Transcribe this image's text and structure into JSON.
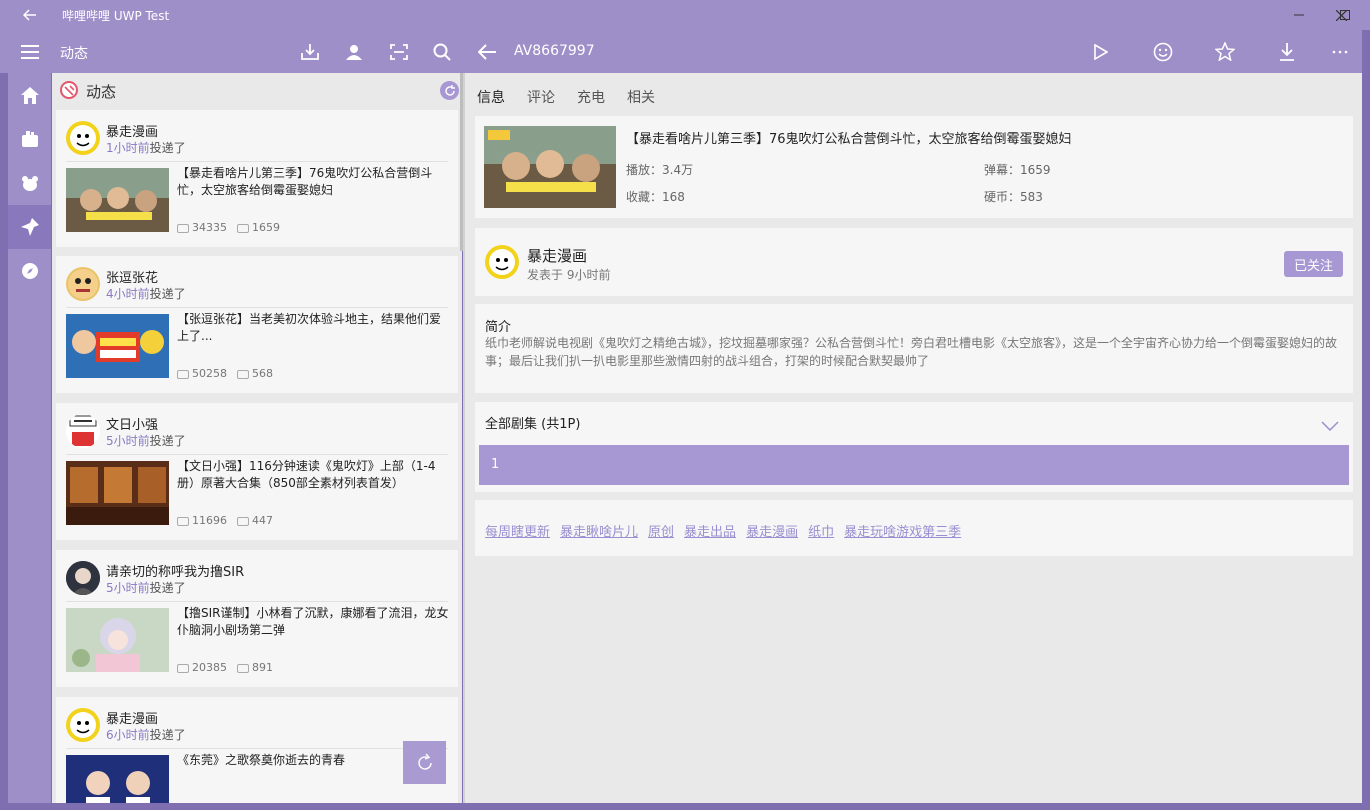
{
  "window": {
    "title": "哔哩哔哩 UWP Test"
  },
  "toolbar": {
    "section_label": "动态",
    "av_id": "AV8667997"
  },
  "list": {
    "header": "动态",
    "cards": [
      {
        "user": "暴走漫画",
        "time": "1小时前",
        "action": "投递了",
        "title": "【暴走看啥片儿第三季】76鬼吹灯公私合营倒斗忙，太空旅客给倒霉蛋娶媳妇",
        "plays": "34335",
        "danmaku": "1659"
      },
      {
        "user": "张逗张花",
        "time": "4小时前",
        "action": "投递了",
        "title": "【张逗张花】当老美初次体验斗地主，结果他们爱上了...",
        "plays": "50258",
        "danmaku": "568"
      },
      {
        "user": "文日小强",
        "time": "5小时前",
        "action": "投递了",
        "title": "【文日小强】116分钟速读《鬼吹灯》上部（1-4册）原著大合集（850部全素材列表首发）",
        "plays": "11696",
        "danmaku": "447"
      },
      {
        "user": "请亲切的称呼我为撸SIR",
        "time": "5小时前",
        "action": "投递了",
        "title": "【撸SIR谨制】小林看了沉默，康娜看了流泪，龙女仆脑洞小剧场第二弹",
        "plays": "20385",
        "danmaku": "891"
      },
      {
        "user": "暴走漫画",
        "time": "6小时前",
        "action": "投递了",
        "title": "《东莞》之歌祭奠你逝去的青春",
        "plays": "",
        "danmaku": ""
      }
    ]
  },
  "detail": {
    "tabs": [
      "信息",
      "评论",
      "充电",
      "相关"
    ],
    "video": {
      "title": "【暴走看啥片儿第三季】76鬼吹灯公私合营倒斗忙，太空旅客给倒霉蛋娶媳妇",
      "plays": "播放：3.4万",
      "danmaku": "弹幕：1659",
      "favorites": "收藏：168",
      "coins": "硬币：583"
    },
    "author": {
      "name": "暴走漫画",
      "posted": "发表于 9小时前",
      "follow_label": "已关注"
    },
    "intro": {
      "heading": "简介",
      "text": "纸巾老师解说电视剧《鬼吹灯之精绝古城》，挖坟掘墓哪家强？公私合营倒斗忙！旁白君吐槽电影《太空旅客》，这是一个全宇宙齐心协力给一个倒霉蛋娶媳妇的故事；最后让我们扒一扒电影里那些激情四射的战斗组合，打架的时候配合默契最帅了"
    },
    "episodes": {
      "heading": "全部剧集 (共1P)",
      "items": [
        "1"
      ]
    },
    "tags": [
      "每周瞎更新",
      "暴走瞅啥片儿",
      "原创",
      "暴走出品",
      "暴走漫画",
      "纸巾",
      "暴走玩啥游戏第三季"
    ]
  },
  "colors": {
    "accent": "#9f8fc9",
    "accent_dark": "#8a78bd",
    "link": "#9a8fd0",
    "time_text": "#8a7bc4"
  }
}
